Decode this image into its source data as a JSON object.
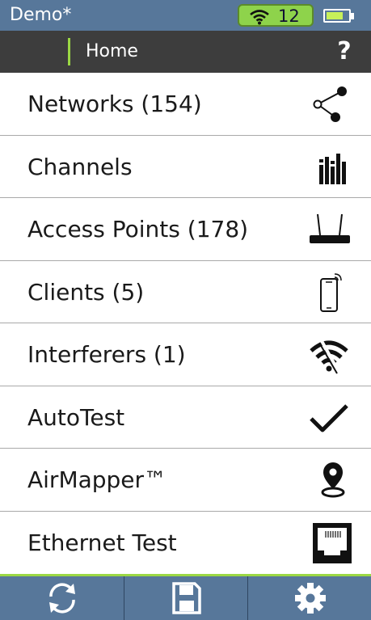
{
  "status": {
    "title": "Demo*",
    "wifi_count": "12",
    "icons": {
      "wifi": "wifi-icon",
      "battery": "battery-icon"
    },
    "battery_level": 0.75,
    "colors": {
      "bar": "#57779a",
      "pill": "#8ed34b",
      "accent": "#9bd844"
    }
  },
  "nav": {
    "title": "Home",
    "help_label": "?"
  },
  "menu": {
    "items": [
      {
        "label": "Networks (154)",
        "icon": "share-network-icon"
      },
      {
        "label": "Channels",
        "icon": "channels-bars-icon"
      },
      {
        "label": "Access Points (178)",
        "icon": "router-icon"
      },
      {
        "label": "Clients (5)",
        "icon": "smartphone-icon"
      },
      {
        "label": "Interferers (1)",
        "icon": "wifi-interference-icon"
      },
      {
        "label": "AutoTest",
        "icon": "checkmark-icon"
      },
      {
        "label": "AirMapper™",
        "icon": "map-pin-icon"
      },
      {
        "label": "Ethernet Test",
        "icon": "ethernet-port-icon"
      }
    ]
  },
  "bottom": {
    "buttons": [
      {
        "icon": "refresh-icon"
      },
      {
        "icon": "save-icon"
      },
      {
        "icon": "settings-gear-icon"
      }
    ]
  }
}
